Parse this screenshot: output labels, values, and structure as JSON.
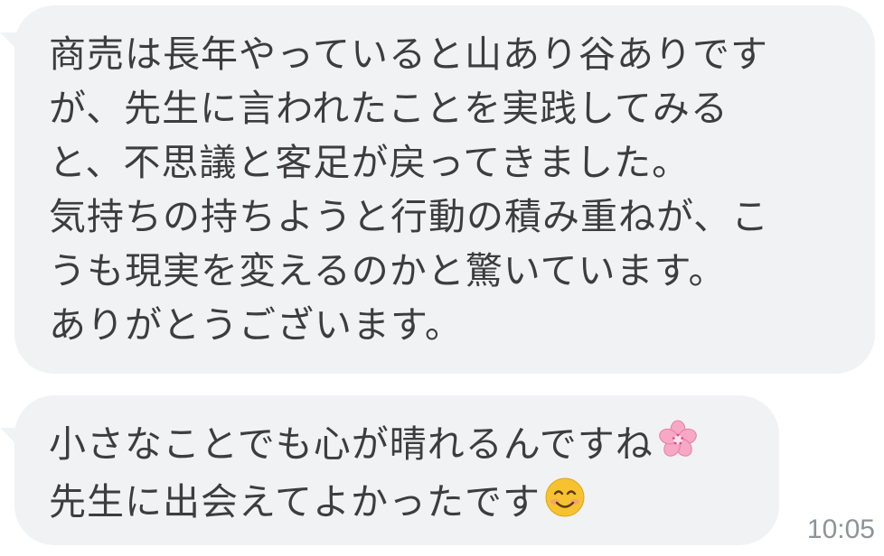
{
  "messages": [
    {
      "lines": [
        "商売は長年やっていると山あり谷ありです",
        "が、先生に言われたことを実践してみる",
        "と、不思議と客足が戻ってきました。",
        "気持ちの持ちようと行動の積み重ねが、こ",
        "うも現実を変えるのかと驚いています。",
        "ありがとうございます。"
      ]
    },
    {
      "lines": [
        "小さなことでも心が晴れるんですね",
        "先生に出会えてよかったです"
      ],
      "emojis": [
        "cherry-blossom-emoji",
        "smiling-face-emoji"
      ],
      "time": "10:05"
    }
  ],
  "colors": {
    "bubble_bg": "#f1f2f4",
    "text": "#3d3d3f",
    "time": "#8f9297",
    "blossom": "#f7a8c4",
    "smiley": "#f7c22f"
  }
}
